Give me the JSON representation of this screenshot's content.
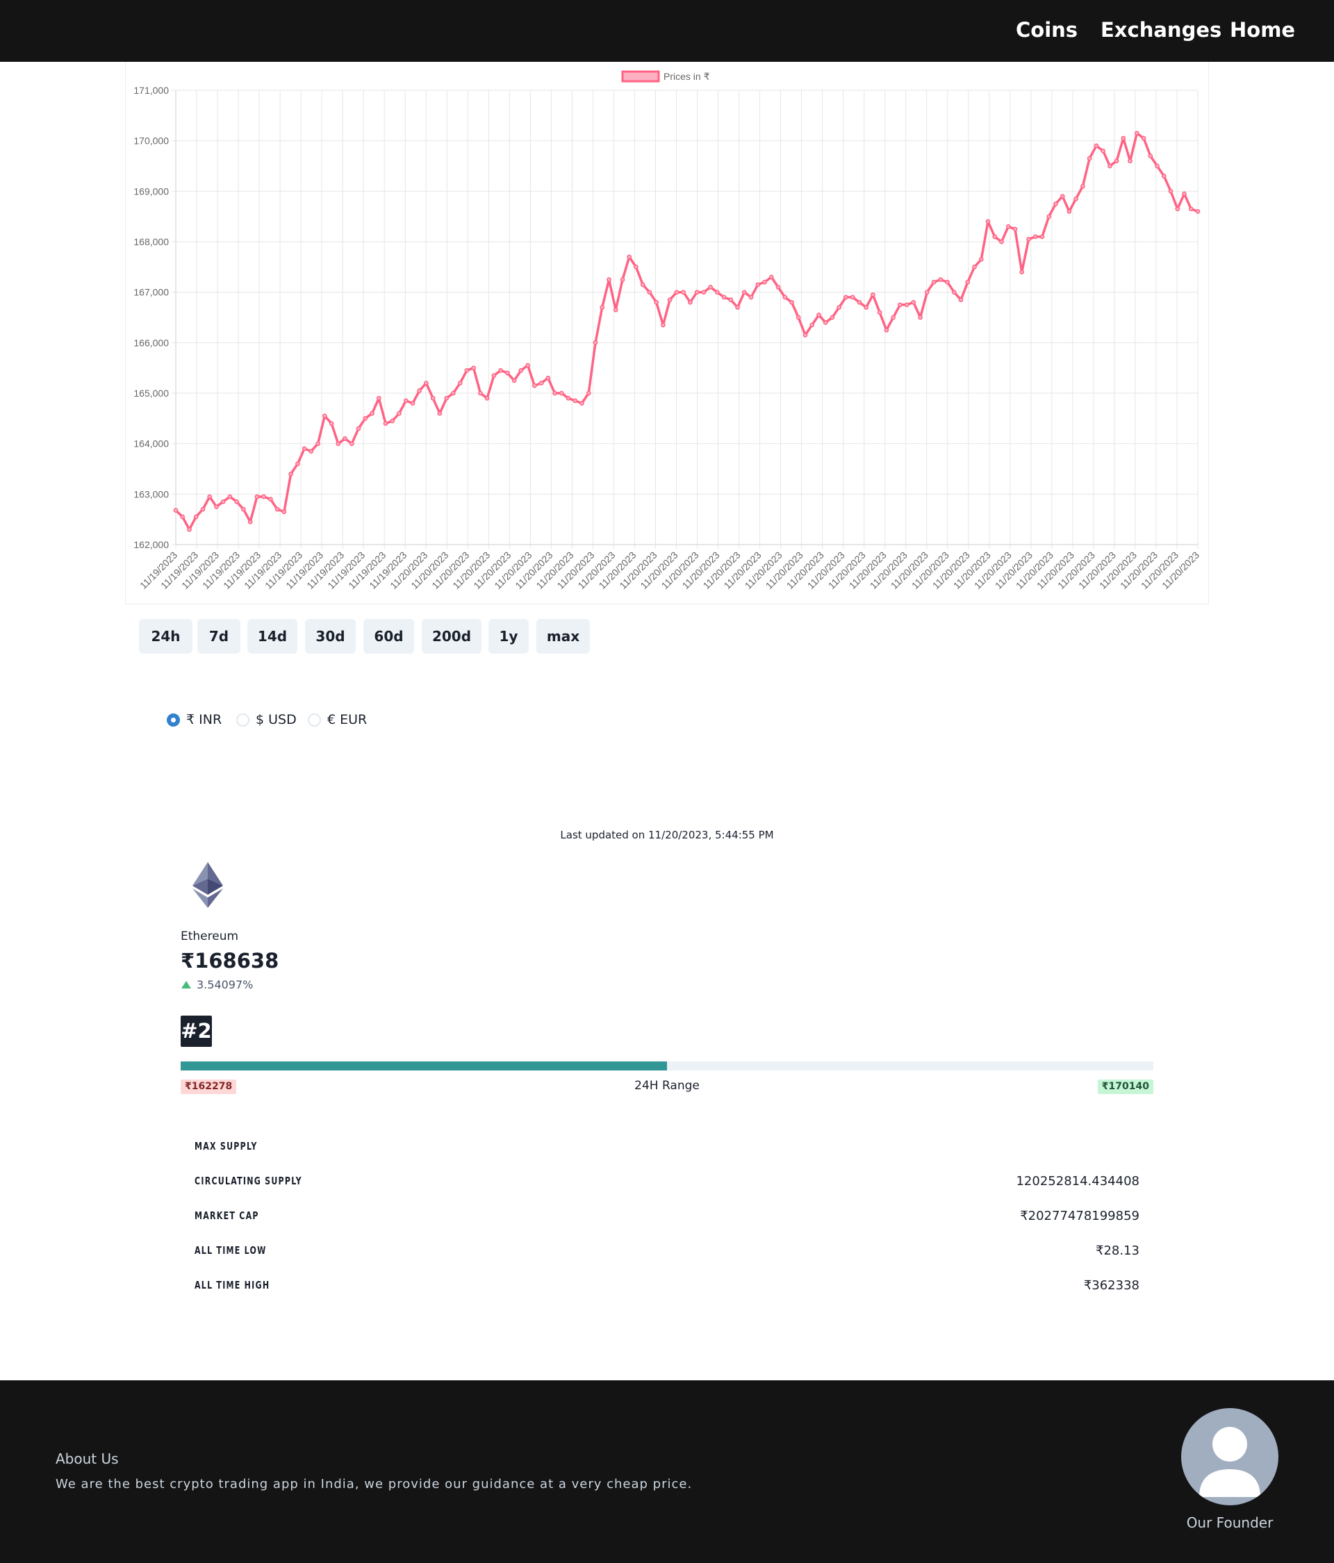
{
  "nav": {
    "links": [
      "Coins",
      "Exchanges",
      "Home"
    ]
  },
  "chart_data": {
    "type": "line",
    "legend": "Prices in ₹",
    "legend_position": "top-center",
    "series_color": "#ff6384",
    "grid": true,
    "ylim": [
      162000,
      171000
    ],
    "yticks": [
      "171,000",
      "170,000",
      "169,000",
      "168,000",
      "167,000",
      "166,000",
      "165,000",
      "164,000",
      "163,000",
      "162,000"
    ],
    "xtick_labels": [
      "11/19/2023",
      "11/19/2023",
      "11/19/2023",
      "11/19/2023",
      "11/19/2023",
      "11/19/2023",
      "11/19/2023",
      "11/19/2023",
      "11/19/2023",
      "11/19/2023",
      "11/19/2023",
      "11/19/2023",
      "11/20/2023",
      "11/20/2023",
      "11/20/2023",
      "11/20/2023",
      "11/20/2023",
      "11/20/2023",
      "11/20/2023",
      "11/20/2023",
      "11/20/2023",
      "11/20/2023",
      "11/20/2023",
      "11/20/2023",
      "11/20/2023",
      "11/20/2023",
      "11/20/2023",
      "11/20/2023",
      "11/20/2023",
      "11/20/2023",
      "11/20/2023",
      "11/20/2023",
      "11/20/2023",
      "11/20/2023",
      "11/20/2023",
      "11/20/2023",
      "11/20/2023",
      "11/20/2023",
      "11/20/2023",
      "11/20/2023",
      "11/20/2023",
      "11/20/2023",
      "11/20/2023",
      "11/20/2023",
      "11/20/2023",
      "11/20/2023",
      "11/20/2023",
      "11/20/2023",
      "11/20/2023",
      "11/20/2023"
    ],
    "values": [
      162680,
      162550,
      162300,
      162550,
      162700,
      162950,
      162750,
      162850,
      162950,
      162850,
      162700,
      162450,
      162950,
      162950,
      162900,
      162700,
      162650,
      163400,
      163600,
      163900,
      163850,
      164000,
      164550,
      164400,
      164000,
      164100,
      164000,
      164300,
      164500,
      164600,
      164900,
      164400,
      164450,
      164600,
      164850,
      164800,
      165050,
      165200,
      164900,
      164600,
      164900,
      165000,
      165200,
      165450,
      165500,
      165000,
      164900,
      165350,
      165450,
      165400,
      165250,
      165450,
      165550,
      165150,
      165200,
      165300,
      165000,
      165000,
      164900,
      164850,
      164800,
      165000,
      166000,
      166700,
      167250,
      166650,
      167250,
      167700,
      167500,
      167150,
      167000,
      166800,
      166350,
      166850,
      167000,
      167000,
      166800,
      167000,
      167000,
      167100,
      167000,
      166900,
      166850,
      166700,
      167000,
      166900,
      167150,
      167200,
      167300,
      167100,
      166900,
      166800,
      166500,
      166150,
      166350,
      166550,
      166400,
      166500,
      166700,
      166900,
      166900,
      166800,
      166700,
      166950,
      166600,
      166250,
      166500,
      166750,
      166750,
      166800,
      166500,
      167000,
      167200,
      167250,
      167200,
      167000,
      166850,
      167200,
      167500,
      167650,
      168400,
      168100,
      168000,
      168300,
      168250,
      167400,
      168050,
      168100,
      168100,
      168500,
      168750,
      168900,
      168600,
      168850,
      169100,
      169650,
      169900,
      169800,
      169500,
      169600,
      170050,
      169600,
      170150,
      170050,
      169700,
      169500,
      169300,
      169000,
      168650,
      168950,
      168650,
      168600
    ]
  },
  "range_buttons": [
    "24h",
    "7d",
    "14d",
    "30d",
    "60d",
    "200d",
    "1y",
    "max"
  ],
  "currency": {
    "options": [
      "₹ INR",
      "$ USD",
      "€ EUR"
    ],
    "selected": "₹ INR"
  },
  "last_updated": "Last updated on 11/20/2023, 5:44:55 PM",
  "coin": {
    "icon": "ethereum-logo",
    "name": "Ethereum",
    "price": "₹168638",
    "change": "3.54097%",
    "rank": "#2"
  },
  "range_24h": {
    "low": "₹162278",
    "high": "₹170140",
    "label": "24H Range",
    "progress_fraction": 0.5
  },
  "stats": [
    {
      "label": "MAX SUPPLY",
      "value": ""
    },
    {
      "label": "CIRCULATING SUPPLY",
      "value": "120252814.434408"
    },
    {
      "label": "MARKET CAP",
      "value": "₹20277478199859"
    },
    {
      "label": "ALL TIME LOW",
      "value": "₹28.13"
    },
    {
      "label": "ALL TIME HIGH",
      "value": "₹362338"
    }
  ],
  "footer": {
    "about_title": "About Us",
    "about_text": "We are the best crypto trading app in India, we provide our guidance at a very cheap price.",
    "founder_label": "Our Founder"
  },
  "colors": {
    "nav_bg": "#141414",
    "line": "#ff6384",
    "progress": "#319795",
    "low_badge": "#fed7d7",
    "high_badge": "#c6f6d5"
  }
}
